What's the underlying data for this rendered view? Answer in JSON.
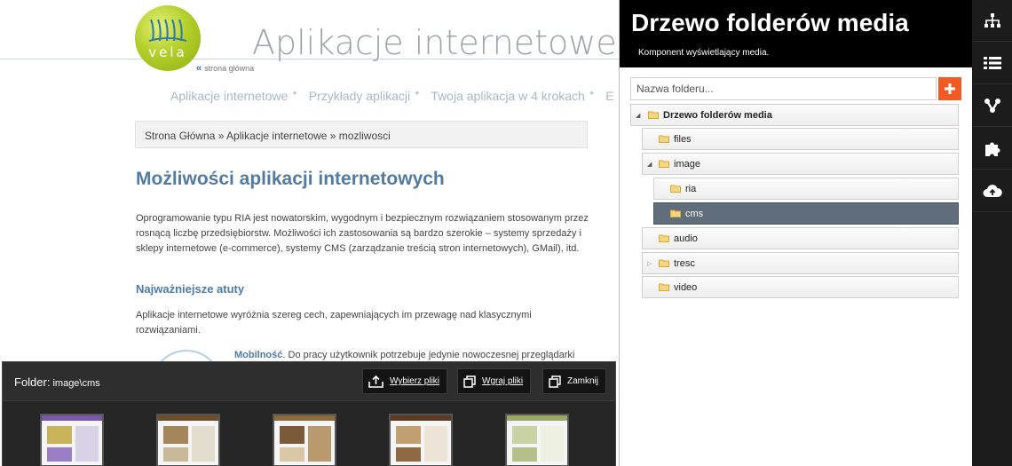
{
  "site": {
    "title": "Aplikacje internetowe z",
    "logo_text": "vela",
    "home_link": "strona główna",
    "nav": [
      "Aplikacje internetowe",
      "Przykłady aplikacji",
      "Twoja aplikacja w 4 krokach",
      "E"
    ],
    "breadcrumb": "Strona Główna » Aplikacje internetowe » mozliwosci",
    "heading": "Możliwości aplikacji internetowych",
    "paragraph1": "Oprogramowanie typu RIA jest nowatorskim, wygodnym i bezpiecznym rozwiązaniem stosowanym przez rosnącą liczbę przedsiębiorstw. Możliwości ich zastosowania są bardzo szerokie – systemy sprzedaży i sklepy internetowe (e-commerce), systemy CMS (zarządzanie treścią stron internetowych), GMail), itd.",
    "subheading": "Najważniejsze atuty",
    "paragraph2": "Aplikacje internetowe wyróżnia szereg cech, zapewniających im przewagę nad klasycznymi rozwiązaniami.",
    "mobility_term": "Mobilność",
    "mobility_text": ". Do pracy użytkownik potrzebuje jedynie nowoczesnej przeglądarki"
  },
  "folder_panel": {
    "label": "Folder:",
    "path": "image\\cms",
    "buttons": {
      "choose": "Wybierz pliki",
      "upload": "Wgraj pliki",
      "close": "Zamknij"
    },
    "thumbnails": [
      {
        "name": "thumb-1",
        "accent": "#7a5aa8"
      },
      {
        "name": "thumb-2",
        "accent": "#6b4e2e"
      },
      {
        "name": "thumb-3",
        "accent": "#8a6a3e"
      },
      {
        "name": "thumb-4",
        "accent": "#5a3a22"
      },
      {
        "name": "thumb-5",
        "accent": "#9aa86a"
      }
    ]
  },
  "tree_panel": {
    "title": "Drzewo folderów media",
    "subtitle": "Komponent wyświetlający media.",
    "search_placeholder": "Nazwa folderu...",
    "accent": "#f15a22",
    "root": "Drzewo folderów media",
    "items": [
      "files",
      "image",
      "ria",
      "cms",
      "audio",
      "tresc",
      "video"
    ],
    "selected": "cms"
  },
  "toolbar": {
    "icons": [
      "sitemap-icon",
      "list-icon",
      "share-nodes-icon",
      "puzzle-icon",
      "cloud-upload-icon"
    ]
  }
}
